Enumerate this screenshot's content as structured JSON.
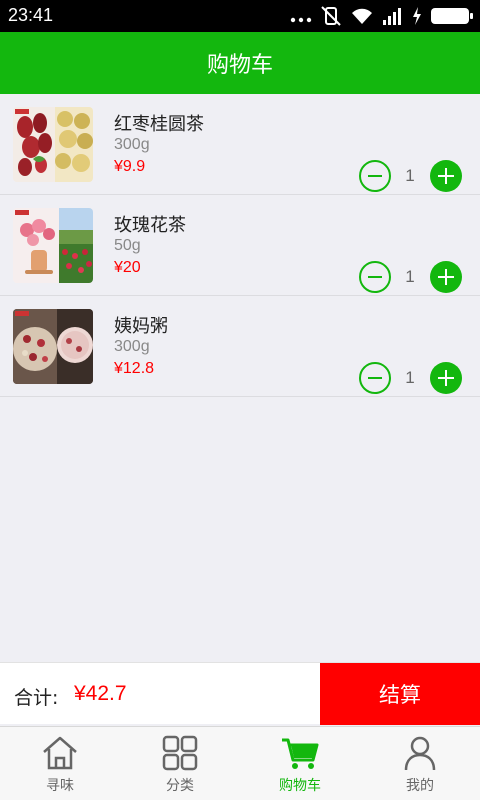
{
  "status_bar": {
    "time": "23:41"
  },
  "header": {
    "title": "购物车"
  },
  "cart": {
    "items": [
      {
        "name": "红枣桂圆茶",
        "weight": "300g",
        "price": "¥9.9",
        "quantity": "1",
        "image": "jujube-longan-tea-photo"
      },
      {
        "name": "玫瑰花茶",
        "weight": "50g",
        "price": "¥20",
        "quantity": "1",
        "image": "rose-tea-photo"
      },
      {
        "name": "姨妈粥",
        "weight": "300g",
        "price": "¥12.8",
        "quantity": "1",
        "image": "red-date-porridge-photo"
      }
    ]
  },
  "summary": {
    "total_label": "合计:",
    "total_value": "¥42.7",
    "checkout_label": "结算"
  },
  "tab_bar": {
    "tabs": [
      {
        "label": "寻味",
        "icon": "home-icon",
        "active": false
      },
      {
        "label": "分类",
        "icon": "grid-icon",
        "active": false
      },
      {
        "label": "购物车",
        "icon": "cart-icon",
        "active": true
      },
      {
        "label": "我的",
        "icon": "user-icon",
        "active": false
      }
    ]
  },
  "colors": {
    "primary": "#13b70e",
    "price": "#ff0000",
    "checkout": "#ff0000",
    "background": "#efeff4"
  }
}
